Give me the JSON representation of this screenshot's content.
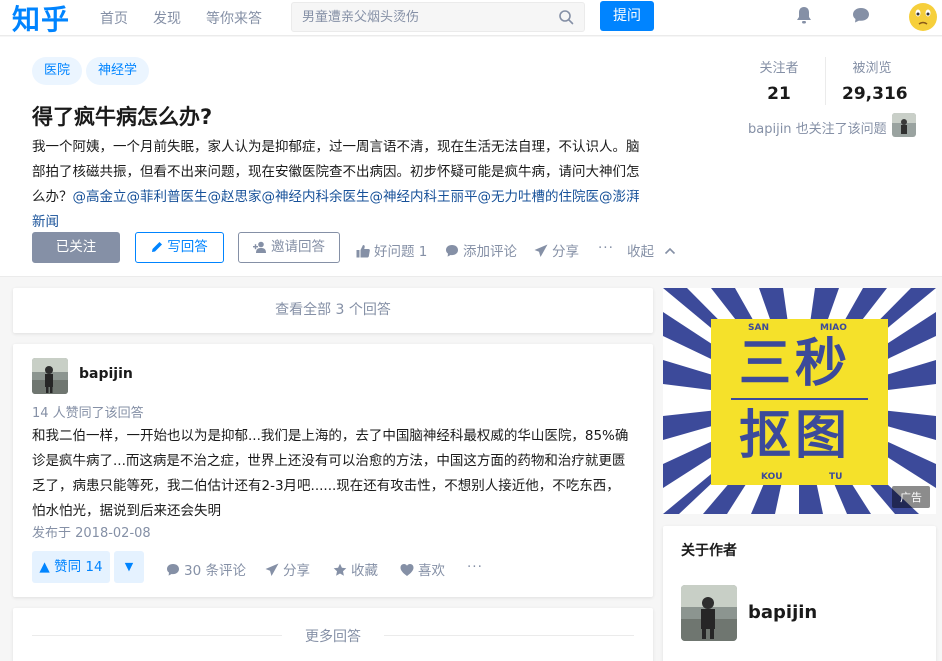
{
  "nav": {
    "logo": "知乎",
    "links": [
      "首页",
      "发现",
      "等你来答"
    ],
    "search_placeholder": "男童遭亲父烟头烫伤",
    "ask_label": "提问"
  },
  "question": {
    "topics": [
      "医院",
      "神经学"
    ],
    "title": "得了疯牛病怎么办?",
    "detail": "我一个阿姨，一个月前失眠，家人认为是抑郁症，过一周言语不清，现在生活无法自理，不认识人。脑部拍了核磁共振，但看不出来问题，现在安徽医院查不出病因。初步怀疑可能是疯牛病，请问大神们怎么办？",
    "mentions": "@高金立@菲利普医生@赵思家@神经内科余医生@神经内科王丽平@无力吐槽的住院医@澎湃新闻",
    "followed_label": "已关注",
    "write_label": "写回答",
    "invite_label": "邀请回答",
    "good_question_label": "好问题 1",
    "add_comment_label": "添加评论",
    "share_label": "分享",
    "more_label": "···",
    "collapse_label": "收起",
    "followers_label": "关注者",
    "followers_value": "21",
    "views_label": "被浏览",
    "views_value": "29,316",
    "also_follow": "bapijin 也关注了该问题"
  },
  "view_all": "查看全部 3 个回答",
  "answer": {
    "author": "bapijin",
    "upvote_note": "14 人赞同了该回答",
    "text": "和我二伯一样，一开始也以为是抑郁...我们是上海的，去了中国脑神经科最权威的华山医院，85%确诊是疯牛病了...而这病是不治之症，世界上还没有可以治愈的方法，中国这方面的药物和治疗就更匮乏了，病患只能等死，我二伯估计还有2-3月吧......现在还有攻击性，不想别人接近他，不吃东西，怕水怕光，据说到后来还会失明",
    "date": "发布于 2018-02-08",
    "vote_label": "▲ 赞同 14",
    "vote_down": "▼",
    "comments_label": "30 条评论",
    "share_label": "分享",
    "collect_label": "收藏",
    "like_label": "喜欢",
    "more_label": "···"
  },
  "more_answers": "更多回答",
  "ad": {
    "pinyin_1": "SAN",
    "pinyin_2": "MIAO",
    "line_1": "三秒",
    "line_2": "抠图",
    "pinyin_3": "KOU",
    "pinyin_4": "TU",
    "ad_label": "广告"
  },
  "about_author": {
    "title": "关于作者",
    "name": "bapijin"
  },
  "colors": {
    "brand": "#0084ff",
    "ad_yellow": "#f5e12a",
    "ad_blue": "#3c4a9a"
  }
}
